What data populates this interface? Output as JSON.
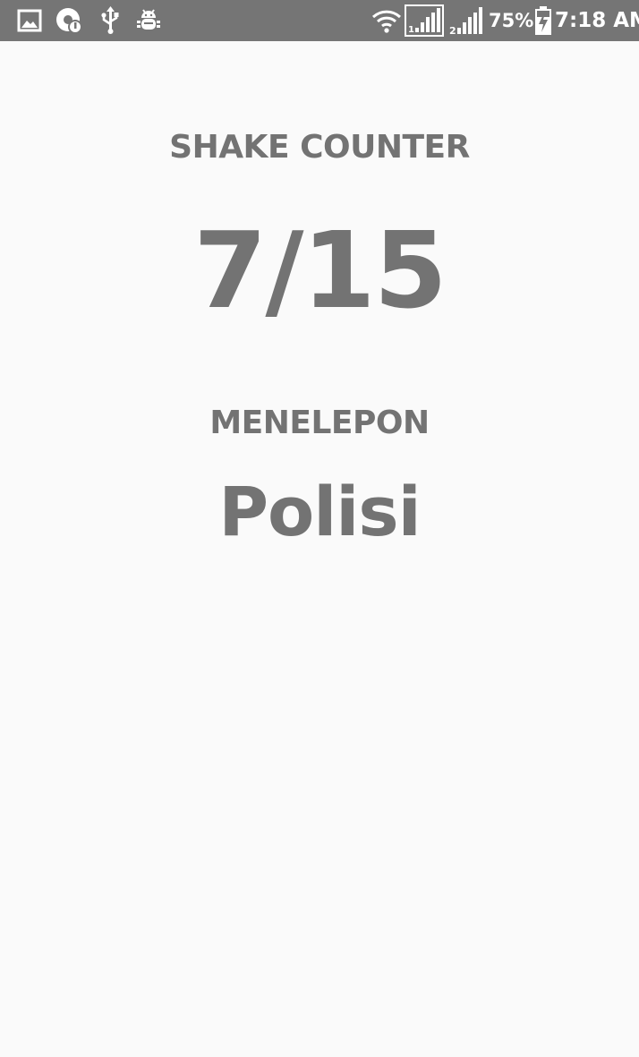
{
  "status_bar": {
    "notifications": [
      "image-icon",
      "data-saver-icon",
      "usb-icon",
      "android-debug-icon"
    ],
    "system_icons": [
      "wifi-icon",
      "signal-sim1-icon",
      "signal-sim2-icon",
      "battery-charging-icon"
    ],
    "battery": "75%",
    "time": "7:18 AM",
    "bg_color": "#757575"
  },
  "main": {
    "title": "SHAKE COUNTER",
    "counter": "7/15",
    "calling_label": "MENELEPON",
    "calling_target": "Polisi",
    "text_color": "#737373",
    "bg_color": "#fafafa"
  }
}
